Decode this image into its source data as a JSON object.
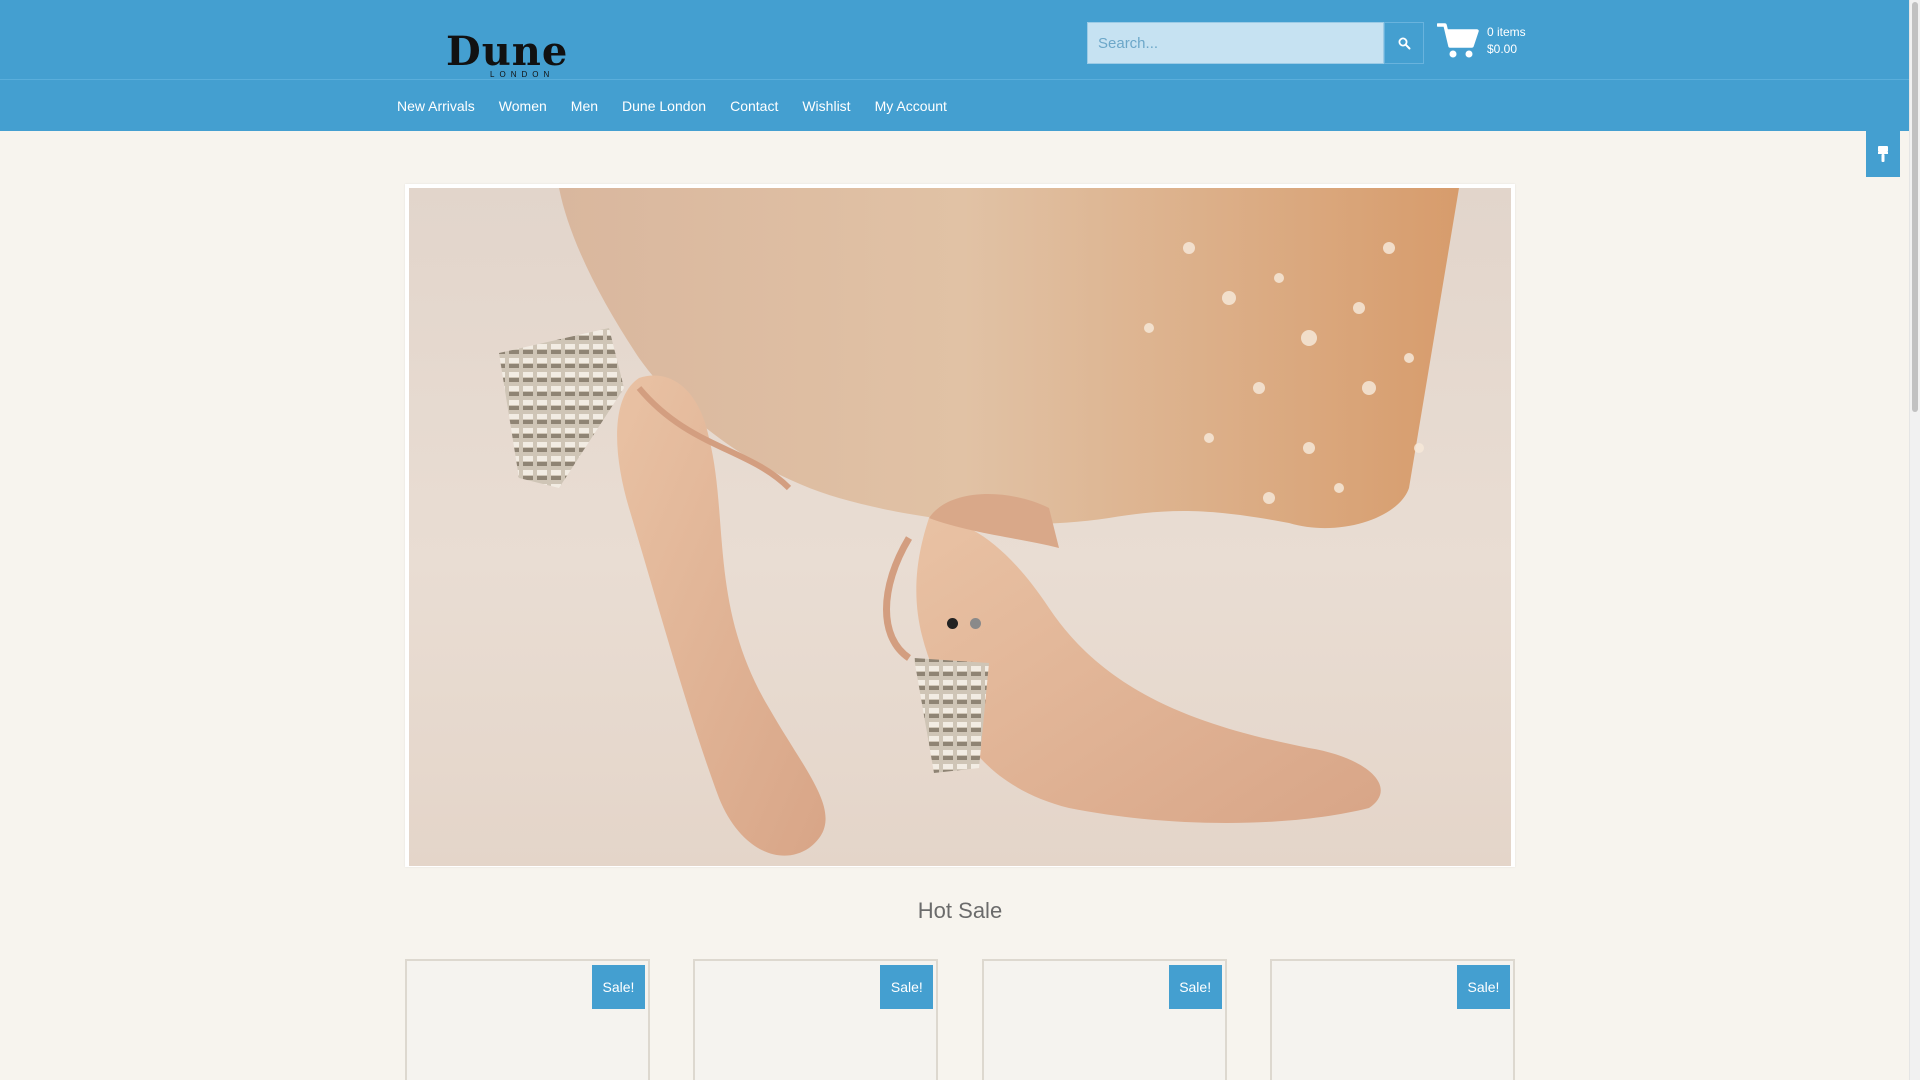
{
  "brand": {
    "name": "Dune",
    "sub": "LONDON"
  },
  "search": {
    "placeholder": "Search..."
  },
  "cart": {
    "items": "0 items",
    "total": "$0.00"
  },
  "nav": [
    {
      "label": "New Arrivals"
    },
    {
      "label": "Women"
    },
    {
      "label": "Men"
    },
    {
      "label": "Dune London"
    },
    {
      "label": "Contact"
    },
    {
      "label": "Wishlist"
    },
    {
      "label": "My Account"
    }
  ],
  "slider": {
    "slide_count": 2,
    "active_index": 0
  },
  "section": {
    "title": "Hot Sale"
  },
  "products": [
    {
      "badge": "Sale!"
    },
    {
      "badge": "Sale!"
    },
    {
      "badge": "Sale!"
    },
    {
      "badge": "Sale!"
    }
  ],
  "colors": {
    "header": "#449fd0",
    "page_bg": "#f7f4ee",
    "dot_active": "#222222",
    "dot_inactive": "#8a8a8a"
  },
  "icons": {
    "search": "search-icon",
    "cart": "shopping-cart-icon",
    "side_tab": "paint-brush-icon"
  }
}
